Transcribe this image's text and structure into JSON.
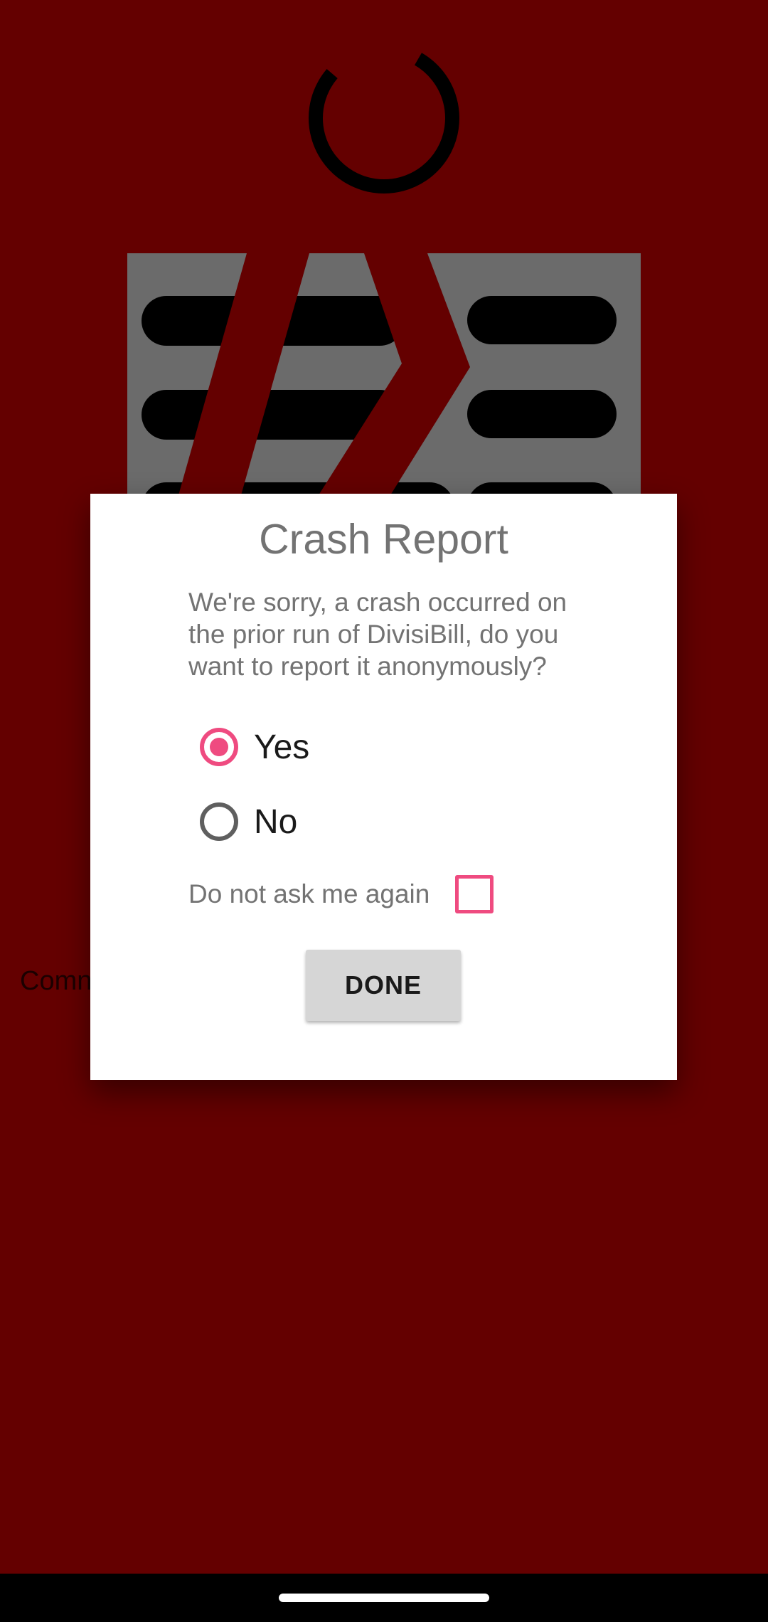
{
  "background": {
    "color": "#640000",
    "partial_text": "Comn"
  },
  "icons": {
    "spinner": "loading-spinner-icon",
    "logo": "divisibill-logo"
  },
  "dialog": {
    "title": "Crash Report",
    "message": "We're sorry, a crash occurred on the prior run of DivisiBill, do you want to report it anonymously?",
    "options": [
      {
        "label": "Yes",
        "selected": true
      },
      {
        "label": "No",
        "selected": false
      }
    ],
    "checkbox": {
      "label": "Do not ask me again",
      "checked": false
    },
    "done_label": "DONE"
  },
  "colors": {
    "accent": "#ef4b80",
    "dialog_text": "#737373",
    "button_bg": "#d6d6d6"
  }
}
